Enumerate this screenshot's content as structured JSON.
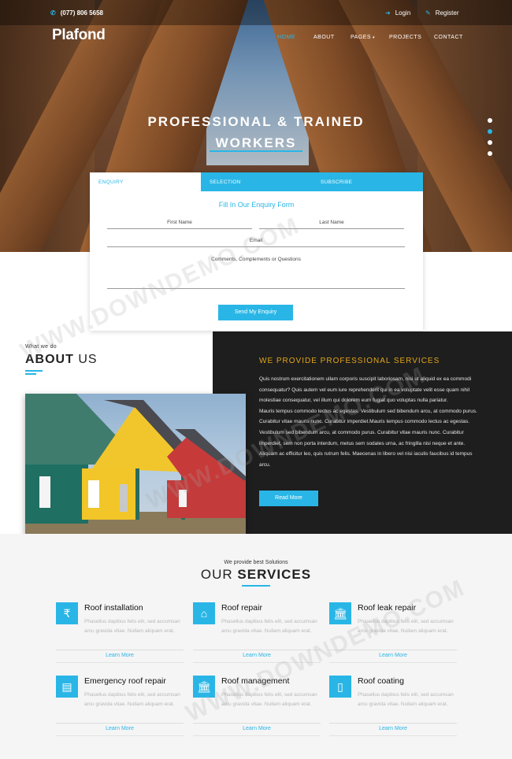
{
  "topbar": {
    "phone": "(077) 806 5658",
    "login": "Login",
    "register": "Register",
    "accent": "#29b6e6"
  },
  "header": {
    "logo": "Plafond",
    "nav": [
      "HOME",
      "ABOUT",
      "PAGES",
      "PROJECTS",
      "CONTACT"
    ]
  },
  "hero": {
    "title_line1": "PROFESSIONAL & TRAINED",
    "title_line2": "WORKERS",
    "slides": 4,
    "active_slide": 2
  },
  "enquiry": {
    "tabs": [
      "ENQUIRY",
      "SELECTION",
      "SUBSCRIBE"
    ],
    "form_title": "Fill In Our Enquiry Form",
    "first_name": "First Name",
    "last_name": "Last Name",
    "email": "Email",
    "comments": "Comments, Complements or Questions",
    "button": "Send My Enquiry"
  },
  "about": {
    "sub": "What we do",
    "title_bold": "ABOUT",
    "title_rest": " US",
    "panel_title": "WE PROVIDE PROFESSIONAL SERVICES",
    "paragraph1": "Quis nostrum exercitationem ullam corporis suscipit laboriosam, nisi ut aliquid ex ea commodi consequatur? Quis autem vel eum iure reprehenderit qui in ea voluptate velit esse quam nihil molestiae consequatur, vel illum qui dolorem eum fugiat quo voluptas nulla pariatur.",
    "paragraph2": "Mauris tempus commodo lectus ac egestas. Vestibulum sed bibendum arcu, at commodo purus. Curabitur vitae mauris nunc. Curabitur imperdiet.Mauris tempus commodo lectus ac egestas. Vestibulum sed bibendum arcu, at commodo purus. Curabitur vitae mauris nunc. Curabitur imperdiet, sem non porta interdum, metus sem sodales urna, ac fringilla nisi neque et ante. Aliquam ac efficitur leo, quis rutrum felis. Maecenas in libero vel nisi iaculis faucibus id tempus arcu.",
    "button": "Read More"
  },
  "services": {
    "sub": "We provide best Solutions",
    "title_rest": "OUR ",
    "title_bold": "SERVICES",
    "items": [
      {
        "name": "Roof installation",
        "icon": "rupee-icon",
        "desc": "Phasellus dapibus felis elit, sed accumsan arcu gravida vitae. Nullam aliquam erat.",
        "link": "Learn More"
      },
      {
        "name": "Roof repair",
        "icon": "home-icon",
        "desc": "Phasellus dapibus felis elit, sed accumsan arcu gravida vitae. Nullam aliquam erat.",
        "link": "Learn More"
      },
      {
        "name": "Roof leak repair",
        "icon": "bank-icon",
        "desc": "Phasellus dapibus felis elit, sed accumsan arcu gravida vitae. Nullam aliquam erat.",
        "link": "Learn More"
      },
      {
        "name": "Emergency roof repair",
        "icon": "document-icon",
        "desc": "Phasellus dapibus felis elit, sed accumsan arcu gravida vitae. Nullam aliquam erat.",
        "link": "Learn More"
      },
      {
        "name": "Roof management",
        "icon": "bank-icon",
        "desc": "Phasellus dapibus felis elit, sed accumsan arcu gravida vitae. Nullam aliquam erat.",
        "link": "Learn More"
      },
      {
        "name": "Roof coating",
        "icon": "mobile-icon",
        "desc": "Phasellus dapibus felis elit, sed accumsan arcu gravida vitae. Nullam aliquam erat.",
        "link": "Learn More"
      }
    ]
  },
  "watermark": "WWW.DOWNDEMO.COM"
}
